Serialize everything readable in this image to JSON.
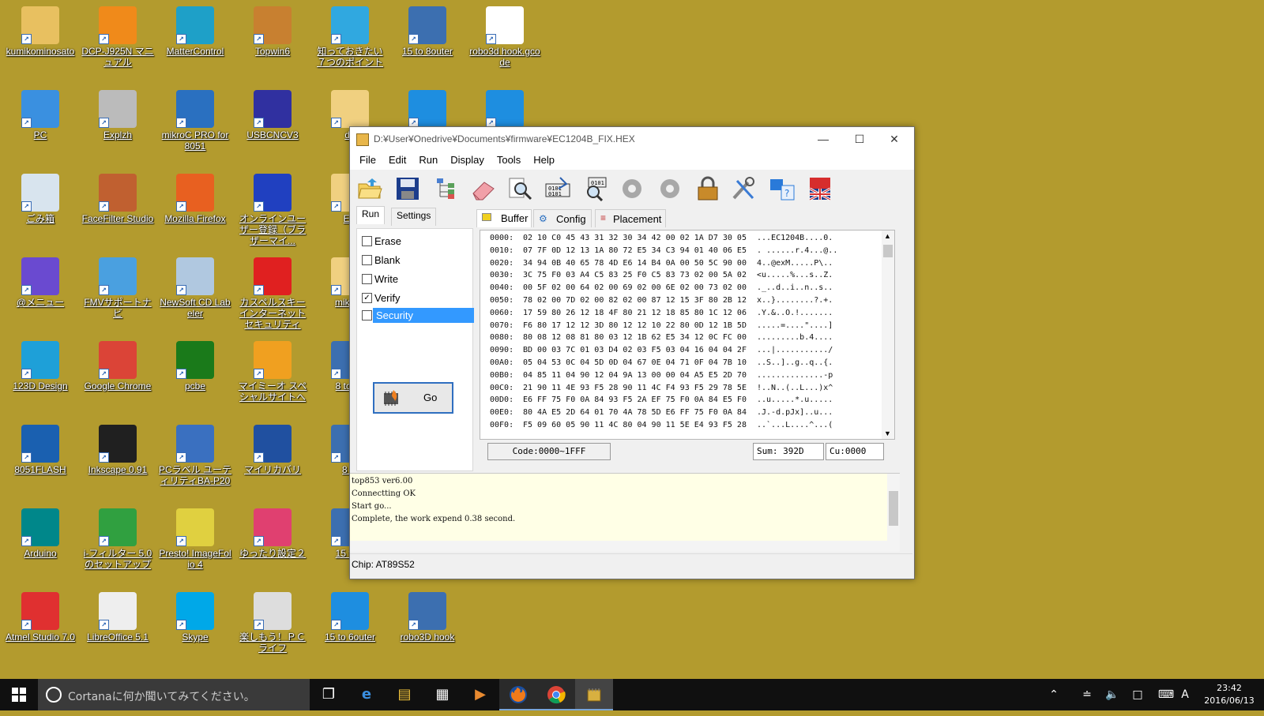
{
  "desktop": {
    "icons": [
      {
        "label": "kumikominosato",
        "icon": "user-folder-icon"
      },
      {
        "label": "DCP-J925N マニュアル",
        "icon": "manual-icon"
      },
      {
        "label": "MatterControl",
        "icon": "mattercontrol-icon"
      },
      {
        "label": "Topwin6",
        "icon": "topwin-icon"
      },
      {
        "label": "知っておきたい７つのポイント",
        "icon": "windows7-icon"
      },
      {
        "label": "15 to 8outer",
        "icon": "shortcut-icon"
      },
      {
        "label": "robo3d hook.gcode",
        "icon": "document-icon"
      },
      {
        "label": "PC",
        "icon": "computer-icon"
      },
      {
        "label": "Explzh",
        "icon": "explzh-icon"
      },
      {
        "label": "mikroC PRO for 8051",
        "icon": "mikroc-icon"
      },
      {
        "label": "USBCNCV3",
        "icon": "usb-icon"
      },
      {
        "label": "d5",
        "icon": "folder-icon"
      },
      {
        "label": "",
        "icon": "blue-shape-icon"
      },
      {
        "label": "",
        "icon": "blue-shape-icon"
      },
      {
        "label": "ごみ箱",
        "icon": "recycle-bin-icon"
      },
      {
        "label": "FaceFilter Studio",
        "icon": "eye-icon"
      },
      {
        "label": "Mozilla Firefox",
        "icon": "firefox-icon"
      },
      {
        "label": "オンラインユーザー登録（ブラザーマイ...",
        "icon": "pen-icon"
      },
      {
        "label": "EC",
        "icon": "folder-icon"
      },
      {
        "label": "@メニュー",
        "icon": "menu-icon"
      },
      {
        "label": "FMVサポートナビ",
        "icon": "support-icon"
      },
      {
        "label": "NewSoft CD Labeler",
        "icon": "cd-icon"
      },
      {
        "label": "カスペルスキー インターネット セキュリティ",
        "icon": "kaspersky-icon"
      },
      {
        "label": "mikroC",
        "icon": "folder-icon"
      },
      {
        "label": "123D Design",
        "icon": "design-icon"
      },
      {
        "label": "Google Chrome",
        "icon": "chrome-icon"
      },
      {
        "label": "pcbe",
        "icon": "pcbe-icon"
      },
      {
        "label": "マイミーオ スペシャルサイトへ",
        "icon": "mymio-icon"
      },
      {
        "label": "8 to 6o",
        "icon": "shortcut-icon"
      },
      {
        "label": "8051FLASH",
        "icon": "flash-icon"
      },
      {
        "label": "Inkscape 0.91",
        "icon": "inkscape-icon"
      },
      {
        "label": "PCラベル ユーティリティBA-P20",
        "icon": "label-icon"
      },
      {
        "label": "マイリカバリ",
        "icon": "recovery-icon"
      },
      {
        "label": "8 to",
        "icon": "shortcut-icon"
      },
      {
        "label": "Arduino",
        "icon": "arduino-icon"
      },
      {
        "label": "i-フィルター 5.0のセットアップ",
        "icon": "filter-icon"
      },
      {
        "label": "Presto! ImageFolio 4",
        "icon": "presto-icon"
      },
      {
        "label": "ゆったり設定２",
        "icon": "heart-icon"
      },
      {
        "label": "15 to 6",
        "icon": "shortcut-icon"
      },
      {
        "label": "Atmel Studio 7.0",
        "icon": "atmel-icon"
      },
      {
        "label": "LibreOffice 5.1",
        "icon": "libreoffice-icon"
      },
      {
        "label": "Skype",
        "icon": "skype-icon"
      },
      {
        "label": "楽しもう！ＰＣライフ",
        "icon": "wdlc-icon"
      },
      {
        "label": "15 to 6outer",
        "icon": "blue-shape-icon"
      },
      {
        "label": "robo3D hook",
        "icon": "shortcut-icon"
      }
    ]
  },
  "window": {
    "title": "D:¥User¥Onedrive¥Documents¥firmware¥EC1204B_FIX.HEX",
    "menu": [
      "File",
      "Edit",
      "Run",
      "Display",
      "Tools",
      "Help"
    ],
    "toolbar_icons": [
      "open-folder-icon",
      "save-icon",
      "tree-icon",
      "eraser-icon",
      "search-icon",
      "read-chip-icon",
      "verify-chip-icon",
      "gear-disabled-icon",
      "gear-disabled-icon",
      "lock-icon",
      "tools-icon",
      "help-icon",
      "language-flag-icon"
    ],
    "left_tabs": [
      "Run",
      "Settings"
    ],
    "checks": [
      {
        "label": "Erase",
        "checked": false
      },
      {
        "label": "Blank",
        "checked": false
      },
      {
        "label": "Write",
        "checked": false
      },
      {
        "label": "Verify",
        "checked": true
      },
      {
        "label": "Security",
        "checked": false
      }
    ],
    "go_label": "Go",
    "right_tabs": [
      "Buffer",
      "Config",
      "Placement"
    ],
    "hex_rows": [
      {
        "addr": "0000:",
        "bytes": "02 10 C0 45 43 31 32 30 34 42 00 02 1A D7 30 05",
        "ascii": "...EC1204B....0."
      },
      {
        "addr": "0010:",
        "bytes": "07 7F 0D 12 13 1A 80 72 E5 34 C3 94 01 40 06 E5",
        "ascii": ". ......r.4...@.."
      },
      {
        "addr": "0020:",
        "bytes": "34 94 0B 40 65 78 4D E6 14 B4 0A 00 50 5C 90 00",
        "ascii": "4..@exM.....P\\.."
      },
      {
        "addr": "0030:",
        "bytes": "3C 75 F0 03 A4 C5 83 25 F0 C5 83 73 02 00 5A 02",
        "ascii": "<u.....%...s..Z."
      },
      {
        "addr": "0040:",
        "bytes": "00 5F 02 00 64 02 00 69 02 00 6E 02 00 73 02 00",
        "ascii": "._..d..i..n..s.."
      },
      {
        "addr": "0050:",
        "bytes": "78 02 00 7D 02 00 82 02 00 87 12 15 3F 80 2B 12",
        "ascii": "x..}........?.+."
      },
      {
        "addr": "0060:",
        "bytes": "17 59 80 26 12 18 4F 80 21 12 18 85 80 1C 12 06",
        "ascii": ".Y.&..O.!......."
      },
      {
        "addr": "0070:",
        "bytes": "F6 80 17 12 12 3D 80 12 12 10 22 80 0D 12 1B 5D",
        "ascii": ".....=....\"....]"
      },
      {
        "addr": "0080:",
        "bytes": "80 08 12 08 81 80 03 12 1B 62 E5 34 12 0C FC 00",
        "ascii": ".........b.4...."
      },
      {
        "addr": "0090:",
        "bytes": "BD 00 03 7C 01 03 D4 02 03 F5 03 04 16 04 04 2F",
        "ascii": "...|.........../"
      },
      {
        "addr": "00A0:",
        "bytes": "05 04 53 0C 04 5D 0D 04 67 0E 04 71 0F 04 7B 10",
        "ascii": "..S..]..g..q..{."
      },
      {
        "addr": "00B0:",
        "bytes": "04 85 11 04 90 12 04 9A 13 00 00 04 A5 E5 2D 70",
        "ascii": "..............-p"
      },
      {
        "addr": "00C0:",
        "bytes": "21 90 11 4E 93 F5 28 90 11 4C F4 93 F5 29 78 5E",
        "ascii": "!..N..(..L...)x^"
      },
      {
        "addr": "00D0:",
        "bytes": "E6 FF 75 F0 0A 84 93 F5 2A EF 75 F0 0A 84 E5 F0",
        "ascii": "..u.....*.u....."
      },
      {
        "addr": "00E0:",
        "bytes": "80 4A E5 2D 64 01 70 4A 78 5D E6 FF 75 F0 0A 84",
        "ascii": ".J.-d.pJx]..u..."
      },
      {
        "addr": "00F0:",
        "bytes": "F5 09 60 05 90 11 4C 80 04 90 11 5E E4 93 F5 28",
        "ascii": "..`...L....^...("
      }
    ],
    "code_range": "Code:0000~1FFF",
    "sum": "Sum:  392D",
    "cu": "Cu:0000",
    "log": [
      "top853 ver6.00",
      "Connectting OK",
      "Start go...",
      "Complete,  the work expend 0.38 second."
    ],
    "chip": "Chip:  AT89S52"
  },
  "taskbar": {
    "search_placeholder": "Cortanaに何か聞いてみてください。",
    "apps": [
      "task-view-icon",
      "edge-icon",
      "explorer-icon",
      "store-icon",
      "media-icon",
      "firefox-icon",
      "chrome-icon",
      "programmer-icon"
    ],
    "time": "23:42",
    "date": "2016/06/13",
    "ime": "A"
  }
}
